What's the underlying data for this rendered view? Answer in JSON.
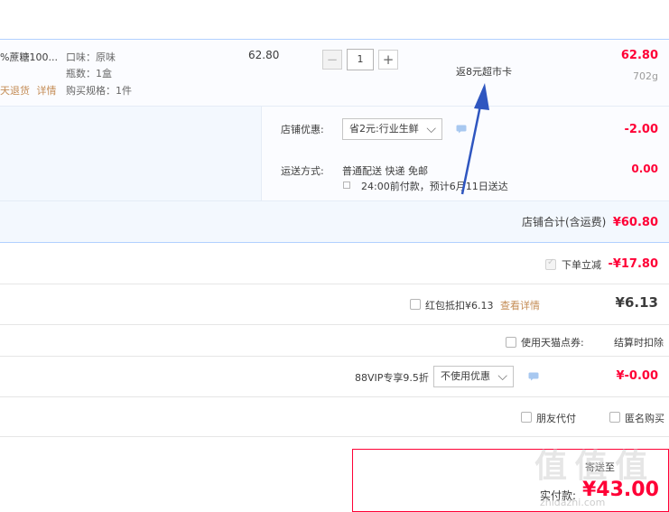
{
  "item": {
    "name": "%蔗糖100...",
    "return_policy": "天退货",
    "details_link": "详情",
    "attrs": [
      "口味：原味",
      "瓶数：1盒",
      "购买规格：1件"
    ],
    "unit_price": "62.80",
    "quantity": "1",
    "decrease_symbol": "−",
    "increase_symbol": "+",
    "subtotal": "62.80",
    "weight": "702g",
    "annotation": "返8元超市卡"
  },
  "shop_section": {
    "discount_label": "店铺优惠:",
    "discount_select": "省2元:行业生鲜",
    "discount_value": "-2.00",
    "shipping_label": "运送方式:",
    "shipping_method": "普通配送 快递 免邮",
    "shipping_note": "24:00前付款，预计6月11日送达",
    "shipping_value": "0.00",
    "shop_total_label": "店铺合计(含运费)",
    "shop_total_value": "¥60.80"
  },
  "instant_discount": {
    "label": "下单立减",
    "value": "-¥17.80",
    "checked": true
  },
  "red_packet": {
    "label": "红包抵扣¥6.13",
    "link": "查看详情",
    "value": "¥6.13",
    "checked": false
  },
  "tmall_points": {
    "label": "使用天猫点券:",
    "value": "结算时扣除",
    "checked": false
  },
  "vip": {
    "label": "88VIP专享9.5折",
    "select": "不使用优惠",
    "value": "¥-0.00"
  },
  "friend_pay": {
    "label": "朋友代付",
    "checked": false
  },
  "anonymous": {
    "label": "匿名购买",
    "checked": false
  },
  "summary": {
    "actual_pay_label": "实付款:",
    "actual_pay_value": "¥43.00",
    "partial_label": "寄送至"
  },
  "watermark": {
    "text": "值 值 值",
    "domain": "zhidazhi.com"
  },
  "colors": {
    "accent_red": "#ff0036",
    "panel_blue": "#f3f8fe",
    "border_blue": "#b2d1ff",
    "arrow_blue": "#2f56c0",
    "link_orange": "#c48c55"
  }
}
